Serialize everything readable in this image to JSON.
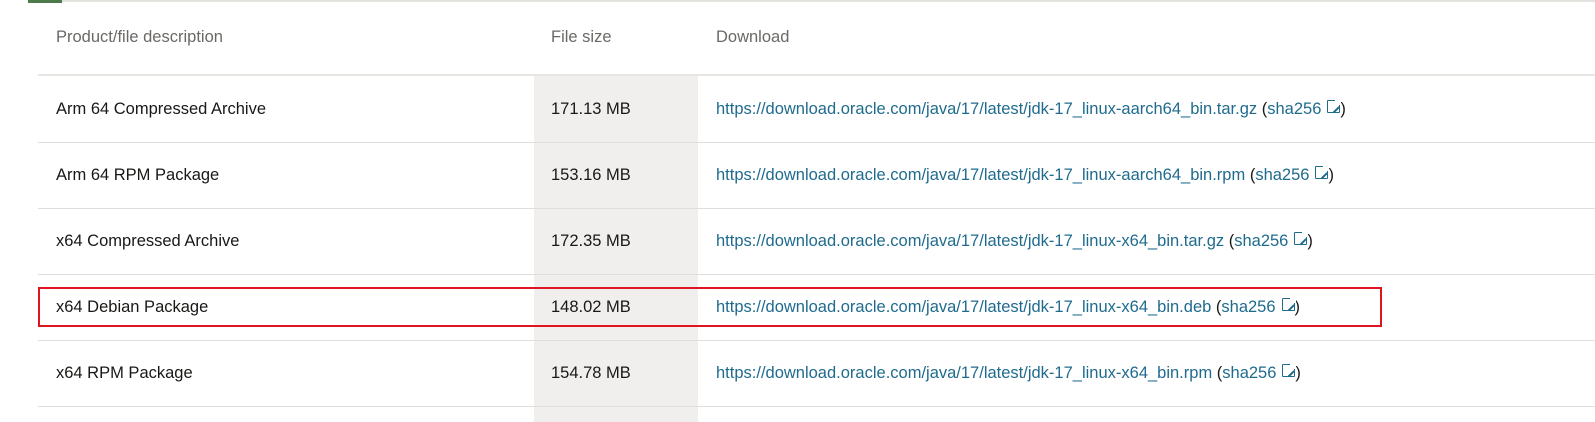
{
  "table": {
    "headers": {
      "description": "Product/file description",
      "size": "File size",
      "download": "Download"
    },
    "checksum_label": "sha256",
    "rows": [
      {
        "description": "Arm 64 Compressed Archive",
        "size": "171.13 MB",
        "url": "https://download.oracle.com/java/17/latest/jdk-17_linux-aarch64_bin.tar.gz"
      },
      {
        "description": "Arm 64 RPM Package",
        "size": "153.16 MB",
        "url": "https://download.oracle.com/java/17/latest/jdk-17_linux-aarch64_bin.rpm"
      },
      {
        "description": "x64 Compressed Archive",
        "size": "172.35 MB",
        "url": "https://download.oracle.com/java/17/latest/jdk-17_linux-x64_bin.tar.gz"
      },
      {
        "description": "x64 Debian Package",
        "size": "148.02 MB",
        "url": "https://download.oracle.com/java/17/latest/jdk-17_linux-x64_bin.deb",
        "highlighted": true
      },
      {
        "description": "x64 RPM Package",
        "size": "154.78 MB",
        "url": "https://download.oracle.com/java/17/latest/jdk-17_linux-x64_bin.rpm"
      }
    ]
  },
  "colors": {
    "link": "#1f6b8e",
    "highlight": "#e0141e",
    "size_column_bg": "#f0efed"
  }
}
